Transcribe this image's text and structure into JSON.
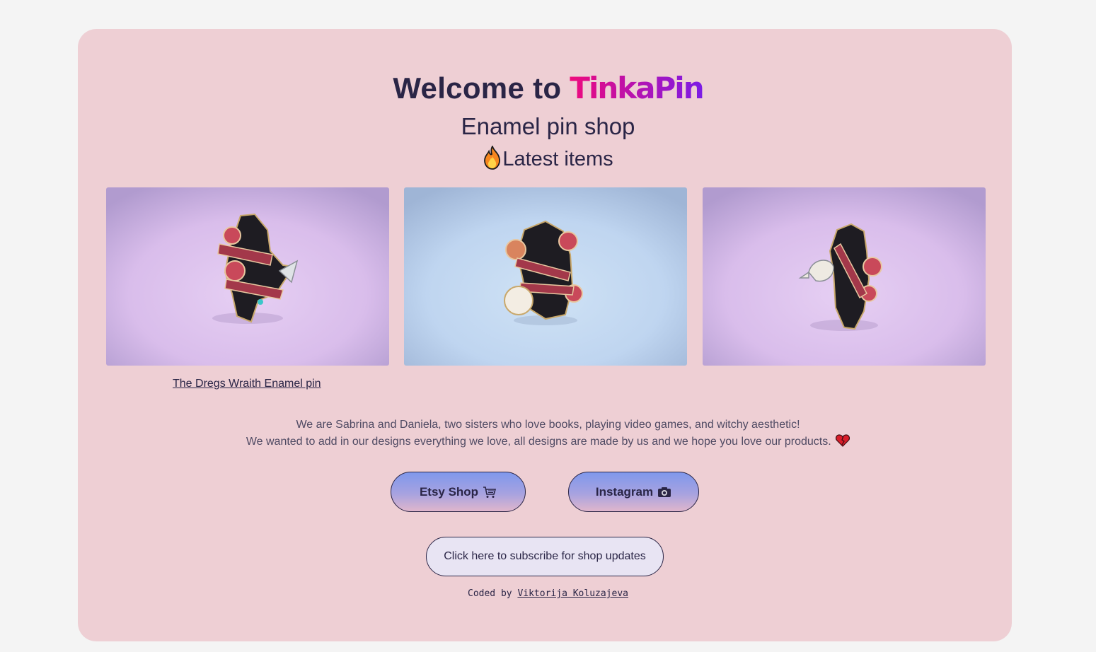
{
  "header": {
    "welcome_prefix": "Welcome to ",
    "brand_name": "TinkaPin",
    "subtitle": "Enamel pin shop",
    "latest_label": "Latest items",
    "latest_icon": "fire-icon"
  },
  "pins": [
    {
      "background": "lavender",
      "caption": "The Dregs Wraith Enamel pin"
    },
    {
      "background": "light-blue"
    },
    {
      "background": "lavender"
    }
  ],
  "about": {
    "line1": "We are Sabrina and Daniela, two sisters who love books, playing video games, and witchy aesthetic!",
    "line2": "We wanted to add in our designs everything we love, all designs are made by us and we hope you love our products.",
    "heart_icon": "heart-icon"
  },
  "buttons": {
    "etsy_label": "Etsy Shop",
    "etsy_icon": "shopping-cart-icon",
    "instagram_label": "Instagram",
    "instagram_icon": "camera-icon",
    "subscribe_label": "Click here to subscribe for shop updates"
  },
  "footer": {
    "prefix": "Coded by",
    "author": "Viktorija Koluzajeva"
  },
  "colors": {
    "page_bg": "#f4f4f4",
    "card_bg": "#eecfd4",
    "text": "#2a2546",
    "brand_start": "#ef0a7c",
    "brand_end": "#7b1ce6"
  }
}
